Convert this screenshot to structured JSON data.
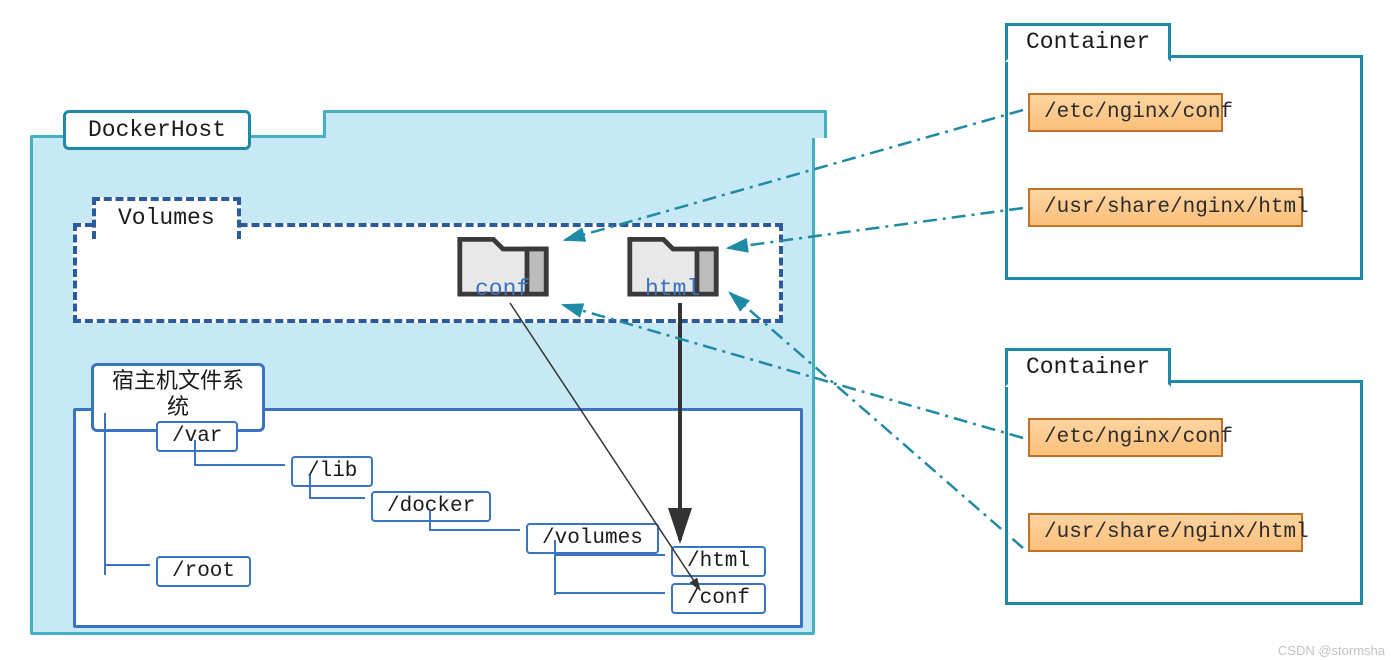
{
  "dockerHost": {
    "label": "DockerHost"
  },
  "volumes": {
    "label": "Volumes",
    "folders": {
      "conf": "conf",
      "html": "html"
    }
  },
  "fs": {
    "label_line1": "宿主机文件系",
    "label_line2": "统",
    "paths": {
      "var": "/var",
      "lib": "/lib",
      "docker": "/docker",
      "volumes": "/volumes",
      "html": "/html",
      "conf": "/conf",
      "root": "/root"
    }
  },
  "container1": {
    "label": "Container",
    "mount1": "/etc/nginx/conf",
    "mount2": "/usr/share/nginx/html"
  },
  "container2": {
    "label": "Container",
    "mount1": "/etc/nginx/conf",
    "mount2": "/usr/share/nginx/html"
  },
  "watermark": "CSDN @stormsha"
}
